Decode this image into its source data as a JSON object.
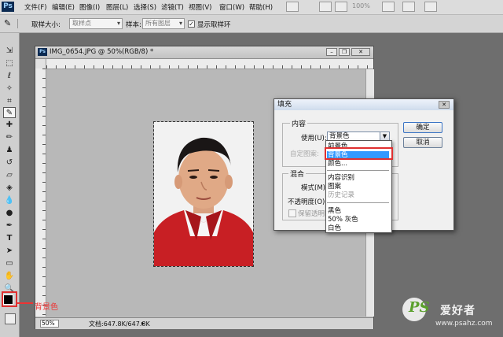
{
  "menubar": {
    "logo": "Ps",
    "items": [
      "文件(F)",
      "编辑(E)",
      "图像(I)",
      "图层(L)",
      "选择(S)",
      "滤镜(T)",
      "视图(V)",
      "窗口(W)",
      "帮助(H)"
    ],
    "zoom": "100%"
  },
  "options": {
    "sample_size_label": "取样大小:",
    "sample_size_value": "取样点",
    "sample_label": "样本:",
    "sample_value": "所有图层",
    "show_ring_label": "显示取样环",
    "show_ring_checked": true
  },
  "document": {
    "title": "IMG_0654.JPG @ 50%(RGB/8) *",
    "zoom": "50%",
    "doc_info": "文档:647.8K/647.8K"
  },
  "dialog": {
    "title": "填充",
    "content_group": "内容",
    "use_label": "使用(U):",
    "use_value": "背景色",
    "custom_pattern_label": "自定图案:",
    "blend_group": "混合",
    "mode_label": "模式(M):",
    "opacity_label": "不透明度(O):",
    "preserve_label": "保留透明区域",
    "ok_label": "确定",
    "cancel_label": "取消",
    "dropdown": {
      "items": [
        "前景色",
        "背景色",
        "颜色...",
        "内容识别",
        "图案",
        "历史记录",
        "黑色",
        "50% 灰色",
        "白色"
      ],
      "selected_index": 1
    }
  },
  "annotation": {
    "label": "背景色",
    "color": "#e03030"
  },
  "watermark": {
    "text1": "PS",
    "text2": "爱好者",
    "url": "www.psahz.com"
  },
  "colors": {
    "selection": "#3399ff",
    "shirt": "#c81f24"
  }
}
